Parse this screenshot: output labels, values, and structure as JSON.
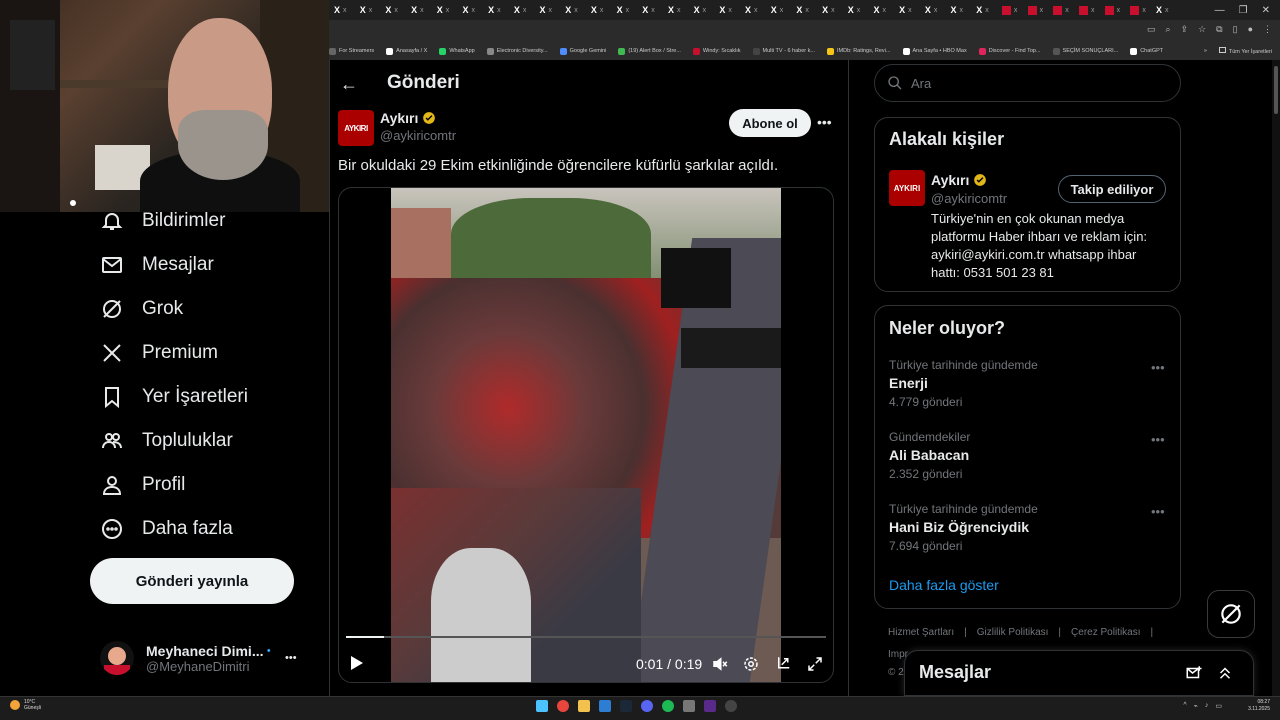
{
  "browser": {
    "tab_close_glyph": "x",
    "bookmarks": [
      {
        "label": "For Streamers",
        "color": "#666666"
      },
      {
        "label": "Anasayfa / X",
        "color": "#ffffff"
      },
      {
        "label": "WhatsApp",
        "color": "#25d366"
      },
      {
        "label": "Electronic Diversity...",
        "color": "#888888"
      },
      {
        "label": "Google Gemini",
        "color": "#4e8cff"
      },
      {
        "label": "(19) Alert Box / Stre...",
        "color": "#3fb950"
      },
      {
        "label": "Windy: Sıcaklık",
        "color": "#c8102e"
      },
      {
        "label": "Multi TV - 6 haber k...",
        "color": "#444444"
      },
      {
        "label": "IMDb: Ratings, Revi...",
        "color": "#f5c518"
      },
      {
        "label": "Ana Sayfa • HBO Max",
        "color": "#ffffff"
      },
      {
        "label": "Discover - Find Top...",
        "color": "#e0245e"
      },
      {
        "label": "SEÇİM SONUÇLARI...",
        "color": "#555555"
      },
      {
        "label": "ChatGPT",
        "color": "#ffffff"
      }
    ],
    "bookmarks_overflow": "»",
    "all_bookmarks": "Tüm Yer İşaretleri"
  },
  "nav": {
    "items": [
      {
        "label": "Bildirimler",
        "icon": "bell-icon"
      },
      {
        "label": "Mesajlar",
        "icon": "mail-icon"
      },
      {
        "label": "Grok",
        "icon": "grok-icon"
      },
      {
        "label": "Premium",
        "icon": "x-logo-icon"
      },
      {
        "label": "Yer İşaretleri",
        "icon": "bookmark-icon"
      },
      {
        "label": "Topluluklar",
        "icon": "people-icon"
      },
      {
        "label": "Profil",
        "icon": "person-icon"
      },
      {
        "label": "Daha fazla",
        "icon": "more-circle-icon"
      }
    ],
    "post_button": "Gönderi yayınla",
    "account": {
      "name": "Meyhaneci Dimi...",
      "handle": "@MeyhaneDimitri",
      "more": "•••"
    }
  },
  "main": {
    "back": "←",
    "title": "Gönderi",
    "tweet": {
      "avatar_text": "AYKIRI",
      "name": "Aykırı",
      "handle": "@aykiricomtr",
      "subscribe": "Abone ol",
      "more": "•••",
      "text": "Bir okuldaki 29 Ekim etkinliğinde öğrencilere küfürlü şarkılar açıldı.",
      "video": {
        "current": "0:01",
        "total": "0:19",
        "time_label": "0:01 / 0:19",
        "progress": 0.08
      }
    }
  },
  "right": {
    "search_placeholder": "Ara",
    "related": {
      "title": "Alakalı kişiler",
      "name": "Aykırı",
      "handle": "@aykiricomtr",
      "follow": "Takip ediliyor",
      "bio": "Türkiye'nin en çok okunan medya platformu Haber ihbarı ve reklam için: aykiri@aykiri.com.tr whatsapp ihbar hattı: 0531 501 23 81"
    },
    "trends": {
      "title": "Neler oluyor?",
      "items": [
        {
          "context": "Türkiye tarihinde gündemde",
          "name": "Enerji",
          "count": "4.779 gönderi"
        },
        {
          "context": "Gündemdekiler",
          "name": "Ali Babacan",
          "count": "2.352 gönderi"
        },
        {
          "context": "Türkiye tarihinde gündemde",
          "name": "Hani Biz Öğrenciydik",
          "count": "7.694 gönderi"
        }
      ],
      "show_more": "Daha fazla göster"
    },
    "footer": [
      "Hizmet Şartları",
      "|",
      "Gizlilik Politikası",
      "|",
      "Çerez Politikası",
      "|"
    ],
    "footer2": "Impr",
    "footer3": "© 2",
    "messages": "Mesajlar"
  },
  "taskbar": {
    "weather_temp": "10°C",
    "weather_desc": "Güneşli",
    "time": "08:27",
    "date": "3.11.2025"
  },
  "colors": {
    "accent": "#1d9bf0",
    "verified": "#e2b719",
    "brand": "#aa0000"
  }
}
